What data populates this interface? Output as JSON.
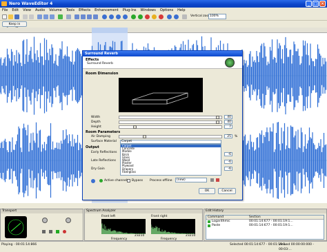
{
  "window": {
    "title": "Nero WaveEditor 4"
  },
  "menu": [
    "File",
    "Edit",
    "View",
    "Audio",
    "Volume",
    "Tools",
    "Effects",
    "Enhancement",
    "Plug-Ins",
    "Windows",
    "Options",
    "Help"
  ],
  "toolbar": {
    "keep_button": "Keep in SoundTrax",
    "vertical_zoom_label": "Vertical zoom:",
    "zoom_value": "100%"
  },
  "dialog": {
    "title": "Surround Reverb",
    "effects_heading": "Effects",
    "effects_sub": "Surround Reverb",
    "room_dimension": "Room Dimension",
    "width_label": "Width",
    "width_value": "40",
    "depth_label": "Depth",
    "depth_value": "40",
    "height_label": "Height",
    "height_value": "7",
    "room_parameters": "Room Parameters",
    "air_damping_label": "Air Damping",
    "air_damping_value": "25",
    "air_damping_unit": "%",
    "surface_label": "Surface Material",
    "surface_value": "Carpet",
    "surface_options": [
      "Carpet",
      "Concrete",
      "Marble",
      "Brick",
      "Glass",
      "Wood",
      "Plaster",
      "Plywood",
      "Drapery",
      "Fiberglass"
    ],
    "output": "Output",
    "early_label": "Early Reflections",
    "early_value": "-6",
    "late_label": "Late Reflections",
    "late_value": "-6",
    "dry_label": "Dry Gain",
    "dry_value": "-6",
    "active_channels": "Active channels",
    "bypass": "Bypass",
    "process_offline": "Process offline",
    "preset_value": "(new)",
    "ok": "OK",
    "cancel": "Cancel"
  },
  "panels": {
    "transport": "Transport",
    "spectrum": "Spectrum Analyzer",
    "front_left": "Front left",
    "front_right": "Front right",
    "frequency": "Frequency",
    "hz": "23210",
    "edit_history": "Edit History",
    "col_command": "Command",
    "col_section": "Section",
    "history": [
      {
        "cmd": "Logarithmic",
        "sec": "00:01:14:677 - 00:01:19:1..."
      },
      {
        "cmd": "Paste",
        "sec": "00:01:14:677 - 00:01:19:1..."
      }
    ]
  },
  "status": {
    "left": "Playing - 00:01:14:866",
    "selected": "Selected 00:01:14:677 - 00:01:19:1...",
    "viewed": "Viewed 00:00:00:000 - 00:03:..."
  }
}
